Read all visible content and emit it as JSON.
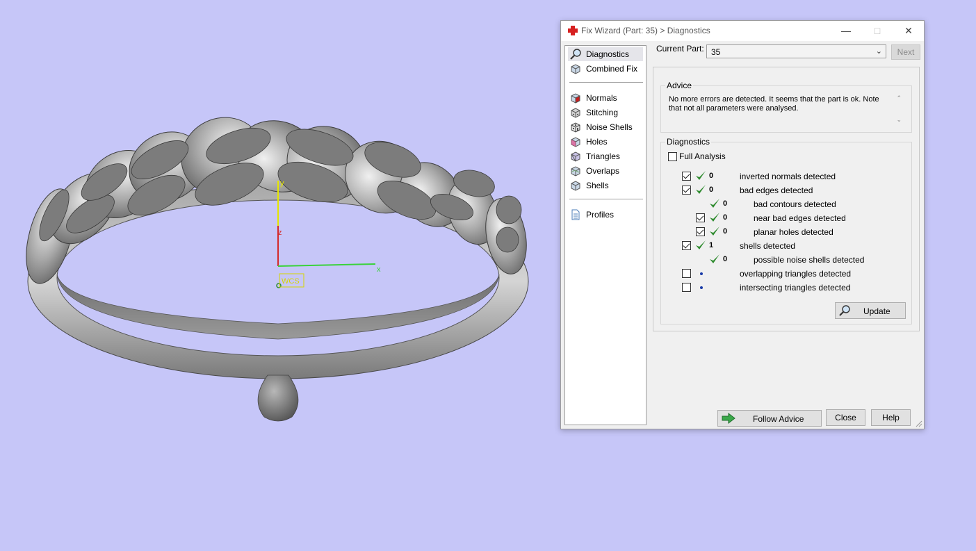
{
  "viewport": {
    "axis_x": "x",
    "axis_y": "y",
    "axis_z": "z",
    "origin_label": "WCS"
  },
  "dialog": {
    "title": "Fix Wizard (Part: 35) > Diagnostics",
    "nav": {
      "items": [
        {
          "label": "Diagnostics",
          "icon": "magnifier-icon"
        },
        {
          "label": "Combined Fix",
          "icon": "cube-icon"
        },
        {
          "label": "Normals",
          "icon": "cube-red-face-icon"
        },
        {
          "label": "Stitching",
          "icon": "cube-stitch-icon"
        },
        {
          "label": "Noise Shells",
          "icon": "dice-icon"
        },
        {
          "label": "Holes",
          "icon": "cube-hole-icon"
        },
        {
          "label": "Triangles",
          "icon": "cube-triangle-icon"
        },
        {
          "label": "Overlaps",
          "icon": "cube-overlap-icon"
        },
        {
          "label": "Shells",
          "icon": "cube-icon"
        },
        {
          "label": "Profiles",
          "icon": "document-icon"
        }
      ]
    },
    "current_part": {
      "label": "Current Part:",
      "value": "35"
    },
    "next_label": "Next",
    "advice": {
      "title": "Advice",
      "text": "No more errors are detected. It seems that the part is ok. Note that not all parameters were analysed."
    },
    "diagnostics": {
      "title": "Diagnostics",
      "full_analysis": "Full Analysis",
      "rows": [
        {
          "count": "0",
          "label": "inverted normals detected",
          "checked": true,
          "status": "ok"
        },
        {
          "count": "0",
          "label": "bad edges detected",
          "checked": true,
          "status": "ok"
        },
        {
          "count": "0",
          "label": "bad contours detected",
          "checked": null,
          "status": "ok"
        },
        {
          "count": "0",
          "label": "near bad edges detected",
          "checked": true,
          "status": "ok"
        },
        {
          "count": "0",
          "label": "planar holes detected",
          "checked": true,
          "status": "ok"
        },
        {
          "count": "1",
          "label": "shells detected",
          "checked": true,
          "status": "ok"
        },
        {
          "count": "0",
          "label": "possible noise shells detected",
          "checked": null,
          "status": "ok"
        },
        {
          "count": "",
          "label": "overlapping triangles detected",
          "checked": false,
          "status": "pending"
        },
        {
          "count": "",
          "label": "intersecting triangles detected",
          "checked": false,
          "status": "pending"
        }
      ],
      "update_label": "Update"
    },
    "buttons": {
      "follow_advice": "Follow Advice",
      "close": "Close",
      "help": "Help"
    },
    "colors": {
      "check": "#2e8b2e",
      "arrow": "#3aa84a",
      "background": "#c6c6f8"
    }
  }
}
